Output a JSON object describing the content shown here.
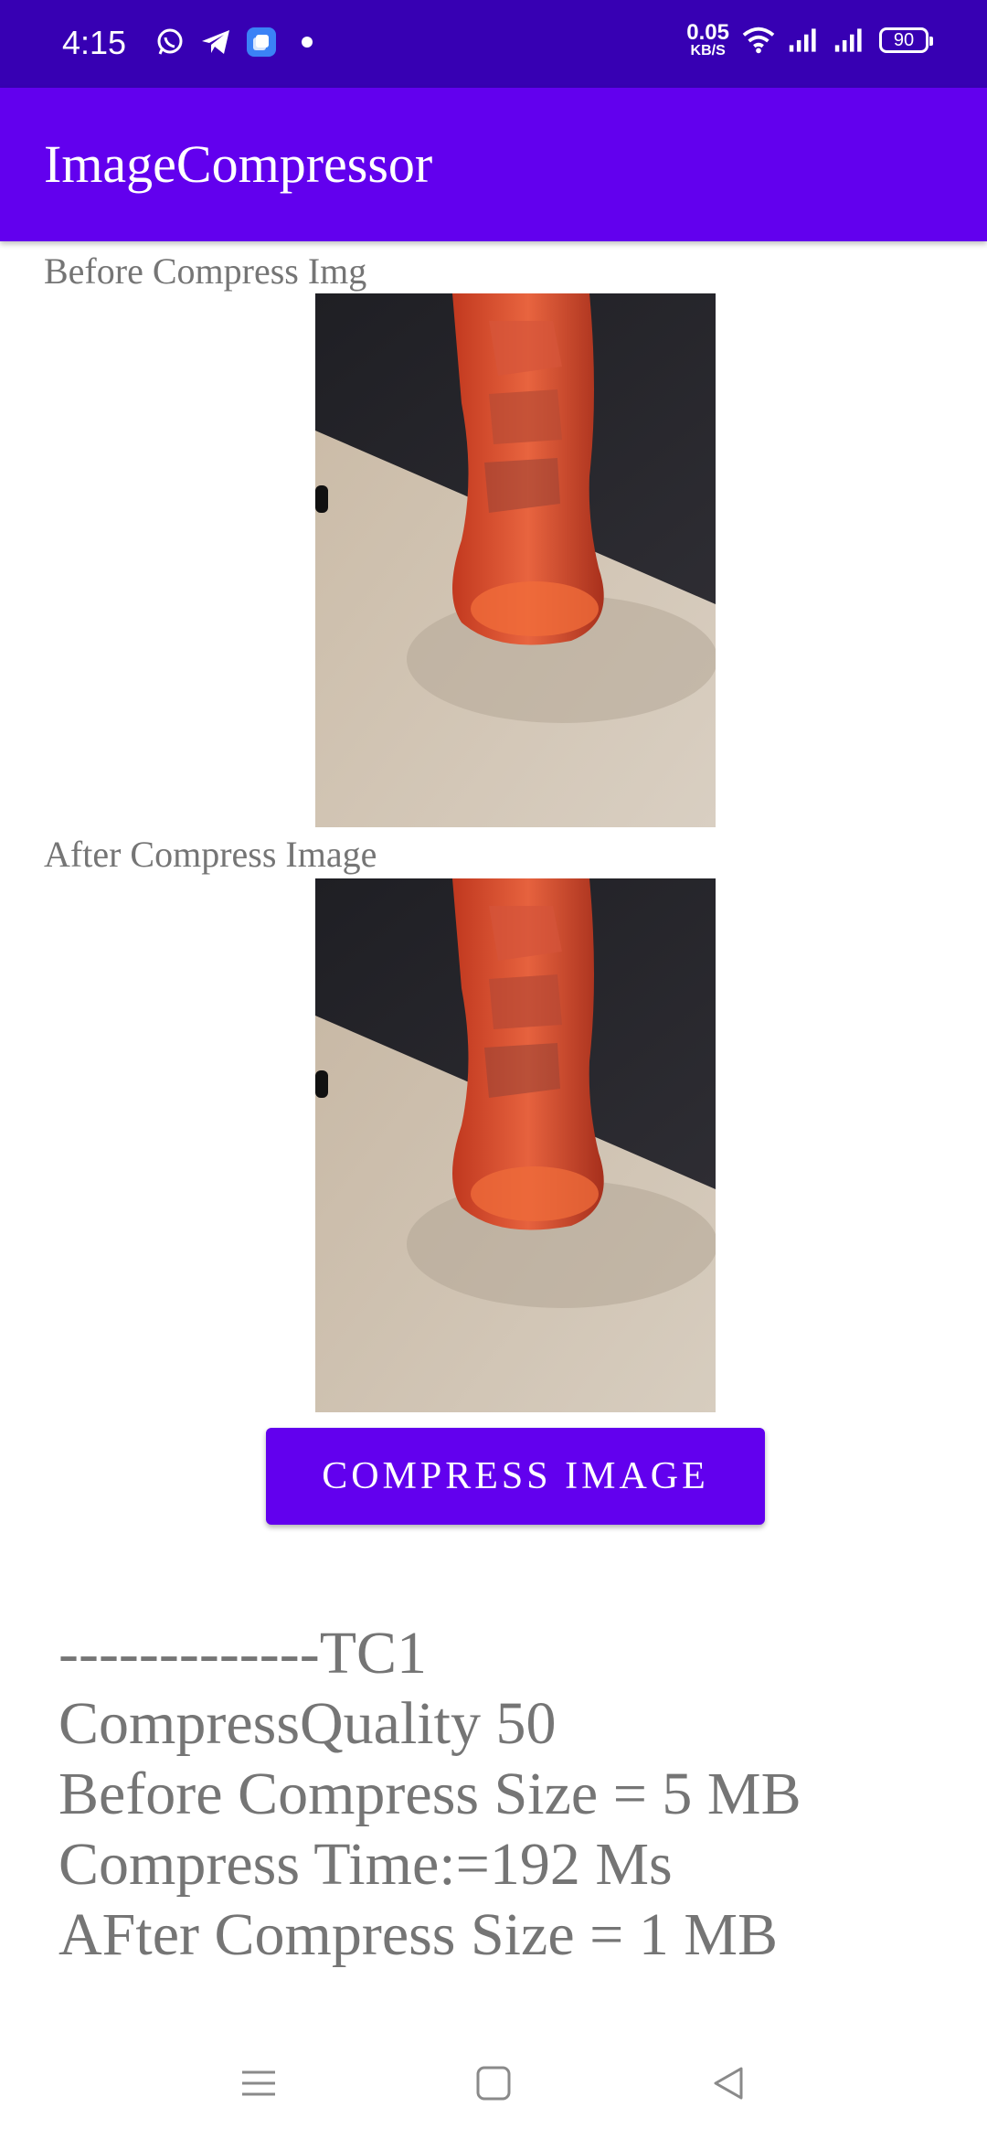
{
  "status_bar": {
    "time": "4:15",
    "net_speed_value": "0.05",
    "net_speed_unit": "KB/S",
    "battery": "90",
    "icons_left": [
      "whatsapp-icon",
      "telegram-icon",
      "app-notification-icon",
      "dot-icon"
    ],
    "icons_right": [
      "wifi-icon",
      "signal-icon",
      "signal-icon"
    ]
  },
  "app_bar": {
    "title": "ImageCompressor"
  },
  "before_section": {
    "label": "Before Compress Img"
  },
  "after_section": {
    "label": "After Compress Image"
  },
  "compress_button": {
    "label": "COMPRESS IMAGE"
  },
  "results": {
    "lines": [
      "-------------TC1",
      "CompressQuality 50",
      "Before Compress Size = 5 MB",
      "Compress Time:=192 Ms",
      "AFter Compress Size = 1 MB"
    ]
  },
  "nav_bar": {
    "buttons": [
      "menu-icon",
      "home-icon",
      "back-icon"
    ]
  },
  "colors": {
    "status_bar": "#3700b3",
    "primary": "#6200ee",
    "text_gray": "#757575"
  }
}
